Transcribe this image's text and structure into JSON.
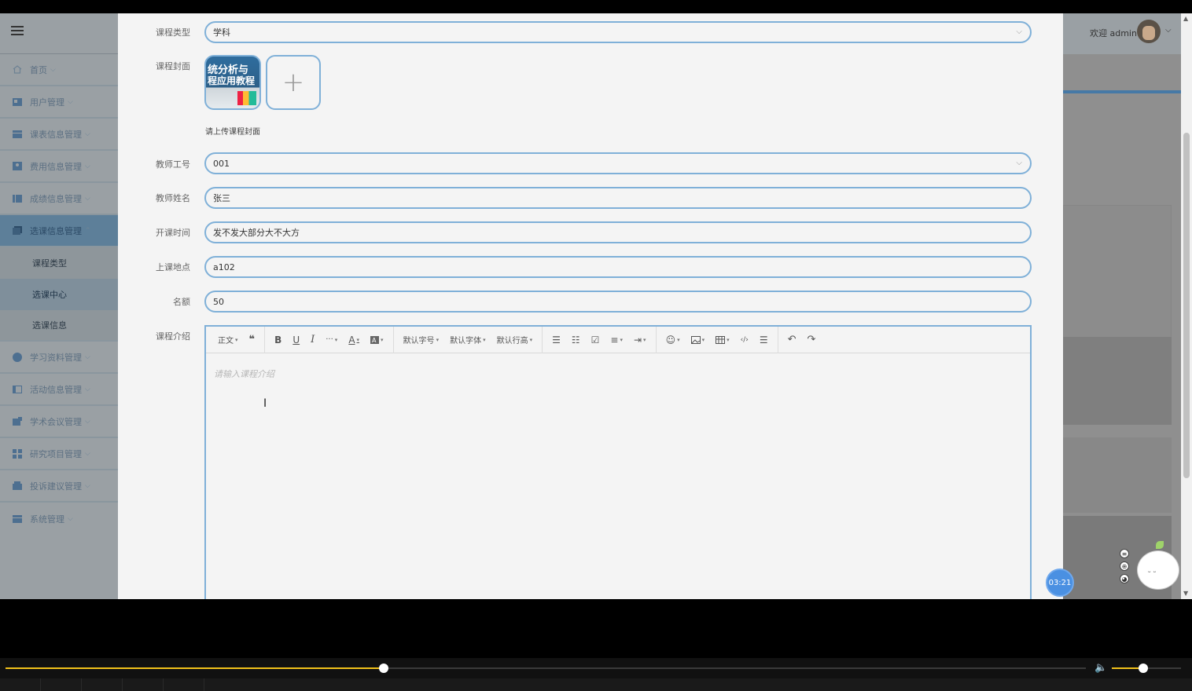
{
  "sidebar": {
    "items": [
      {
        "label": "首页",
        "icon": "home-icon"
      },
      {
        "label": "用户管理",
        "icon": "user-card-icon"
      },
      {
        "label": "课表信息管理",
        "icon": "schedule-icon"
      },
      {
        "label": "费用信息管理",
        "icon": "fee-icon"
      },
      {
        "label": "成绩信息管理",
        "icon": "grades-icon"
      },
      {
        "label": "选课信息管理",
        "icon": "course-select-icon",
        "expanded": true,
        "children": [
          "课程类型",
          "选课中心",
          "选课信息"
        ],
        "current_child": "选课中心"
      },
      {
        "label": "学习资料管理",
        "icon": "materials-icon"
      },
      {
        "label": "活动信息管理",
        "icon": "activity-icon"
      },
      {
        "label": "学术会议管理",
        "icon": "conference-icon"
      },
      {
        "label": "研究项目管理",
        "icon": "project-icon"
      },
      {
        "label": "投诉建议管理",
        "icon": "complaint-icon"
      },
      {
        "label": "系统管理",
        "icon": "system-icon"
      }
    ]
  },
  "header": {
    "welcome": "欢迎 admin"
  },
  "form": {
    "course_type": {
      "label": "课程类型",
      "value": "学科"
    },
    "cover": {
      "label": "课程封面",
      "hint": "请上传课程封面",
      "thumb_line1": "统分析与",
      "thumb_line2": "程应用教程"
    },
    "teacher_id": {
      "label": "教师工号",
      "value": "001"
    },
    "teacher_name": {
      "label": "教师姓名",
      "value": "张三"
    },
    "start_time": {
      "label": "开课时间",
      "value": "发不发大部分大不大方"
    },
    "location": {
      "label": "上课地点",
      "value": "a102"
    },
    "quota": {
      "label": "名额",
      "value": "50"
    },
    "intro": {
      "label": "课程介绍",
      "placeholder": "请输入课程介绍"
    }
  },
  "editor_toolbar": {
    "paragraph": "正文",
    "font_size": "默认字号",
    "font_family": "默认字体",
    "line_height": "默认行高"
  },
  "overlay": {
    "timer": "03:21"
  },
  "player": {
    "progress": 0.35,
    "volume": 0.45
  },
  "colors": {
    "accent": "#7fb0d8",
    "progress": "#f2c21b",
    "active_menu": "#5d7f99"
  }
}
